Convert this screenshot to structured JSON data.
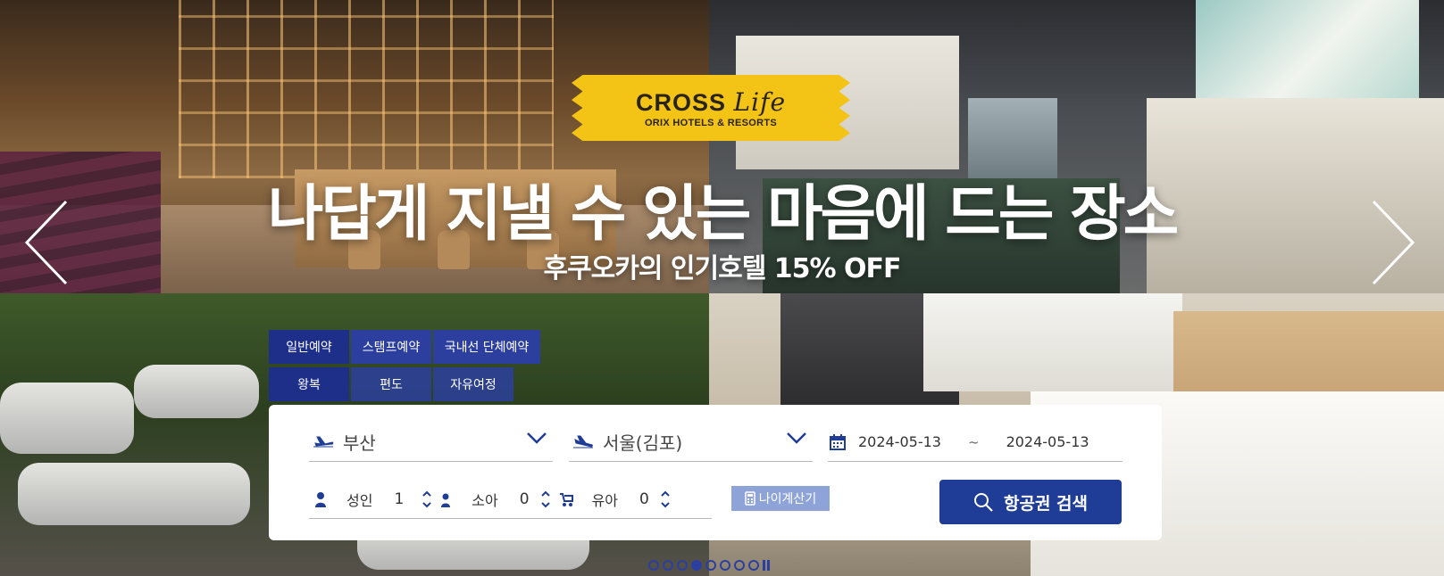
{
  "logo": {
    "word": "CROSS",
    "script": "Life",
    "subtitle": "ORIX HOTELS & RESORTS"
  },
  "hero": {
    "headline": "나답게 지낼 수 있는 마음에 드는 장소",
    "subline": "후쿠오카의 인기호텔 15% OFF"
  },
  "tabs": {
    "row1": [
      "일반예약",
      "스탬프예약",
      "국내선 단체예약"
    ],
    "row2": [
      "왕복",
      "편도",
      "자유여정"
    ]
  },
  "search": {
    "departure": "부산",
    "arrival": "서울(김포)",
    "date_from": "2024-05-13",
    "date_sep": "~",
    "date_to": "2024-05-13",
    "adult_label": "성인",
    "adult_count": "1",
    "child_label": "소아",
    "child_count": "0",
    "infant_label": "유아",
    "infant_count": "0",
    "age_calc_label": "나이계산기",
    "search_label": "항공권 검색"
  },
  "pager": {
    "total": 8,
    "active_index": 3
  },
  "colors": {
    "brand_blue": "#1f3c96",
    "tab_blue": "#2c3f9e",
    "logo_yellow": "#f3c316",
    "age_button": "#8ea3d8"
  }
}
